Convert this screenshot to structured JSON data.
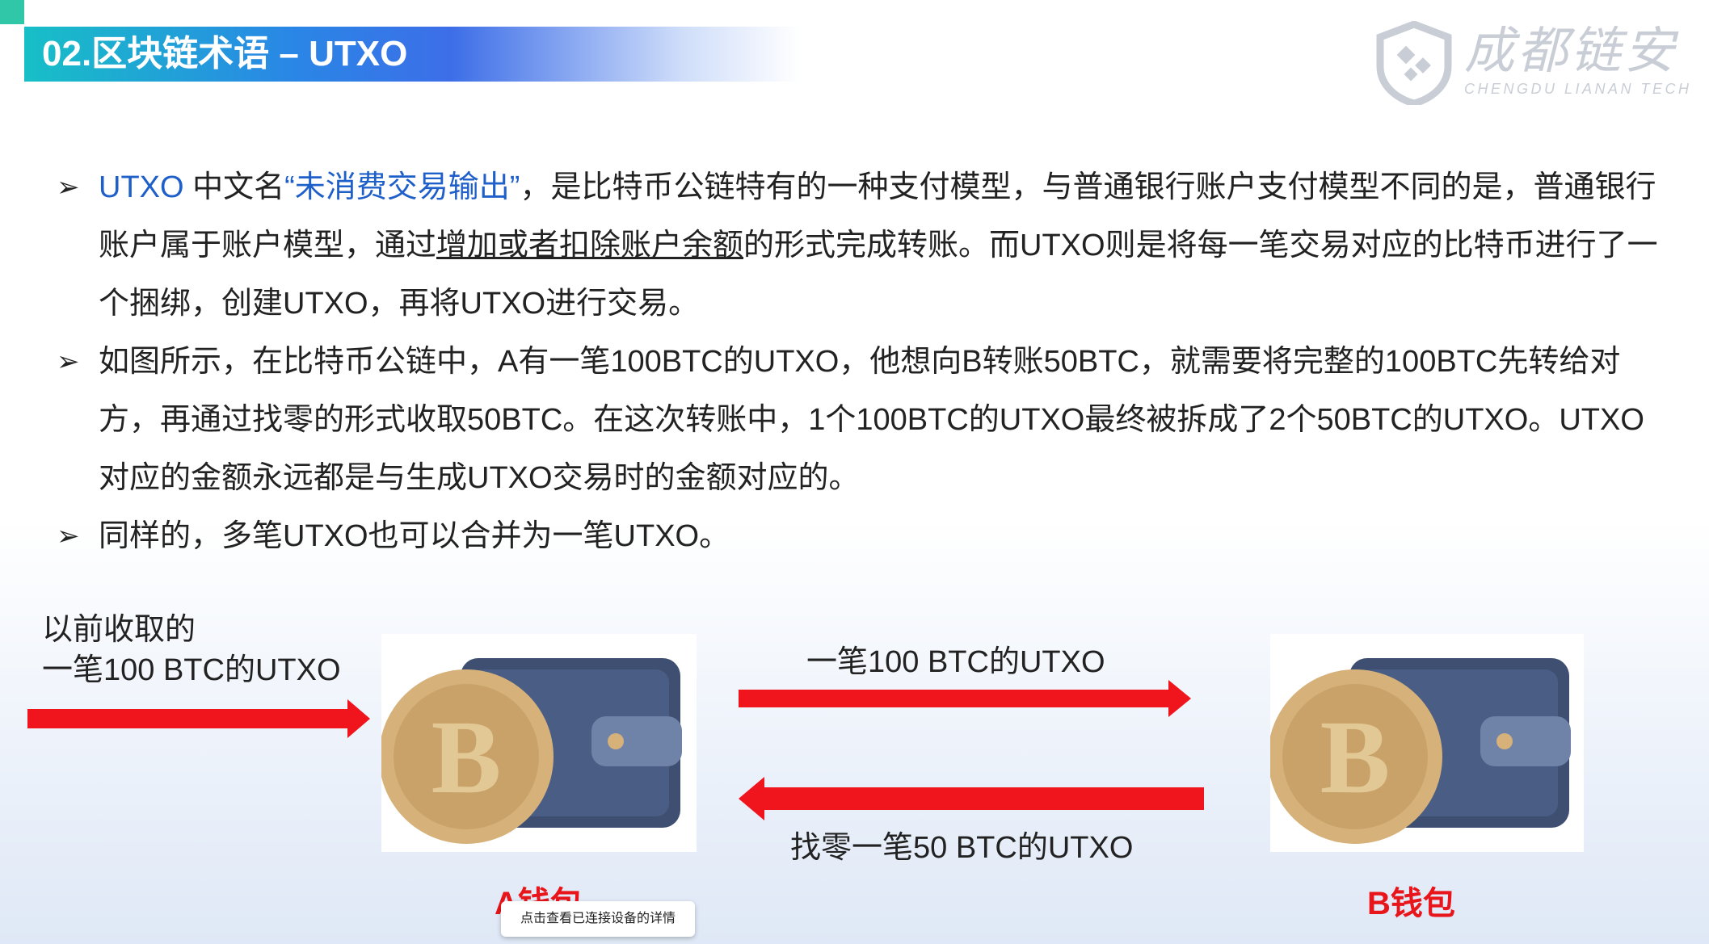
{
  "slide": {
    "title": "02.区块链术语 – UTXO"
  },
  "logo": {
    "name_cn": "成都链安",
    "name_en": "CHENGDU LIANAN TECH"
  },
  "bullets": {
    "b1": {
      "p1": "UTXO",
      "p2": " 中文名",
      "p3": "“未消费交易输出”",
      "p4": "，是比特币公链特有的一种支付模型，与普通银行账户支付模型不同的是，普通银行账户属于账户模型，通过",
      "p5": "增加或者扣除账户余额",
      "p6": "的形式完成转账。而UTXO则是将每一笔交易对应的比特币进行了一个捆绑，创建UTXO，再将UTXO进行交易。"
    },
    "b2": "如图所示，在比特币公链中，A有一笔100BTC的UTXO，他想向B转账50BTC，就需要将完整的100BTC先转给对方，再通过找零的形式收取50BTC。在这次转账中，1个100BTC的UTXO最终被拆成了2个50BTC的UTXO。UTXO对应的金额永远都是与生成UTXO交易时的金额对应的。",
    "b3": "同样的，多笔UTXO也可以合并为一笔UTXO。"
  },
  "diagram": {
    "incoming_line1": "以前收取的",
    "incoming_line2": "一笔100 BTC的UTXO",
    "to_b_label": "一笔100 BTC的UTXO",
    "change_label": "找零一笔50 BTC的UTXO",
    "wallet_a_label": "A钱包",
    "wallet_b_label": "B钱包",
    "coin_symbol": "B"
  },
  "tooltip": "点击查看已连接设备的详情",
  "colors": {
    "arrow_red": "#f0141c",
    "label_red": "#e8151b",
    "title_gradient_start": "#17bfc7",
    "title_gradient_mid": "#3d6ee8",
    "highlight_blue": "#1f5fc9",
    "wallet_body": "#3e4f72",
    "coin_gold": "#d6b27a"
  }
}
